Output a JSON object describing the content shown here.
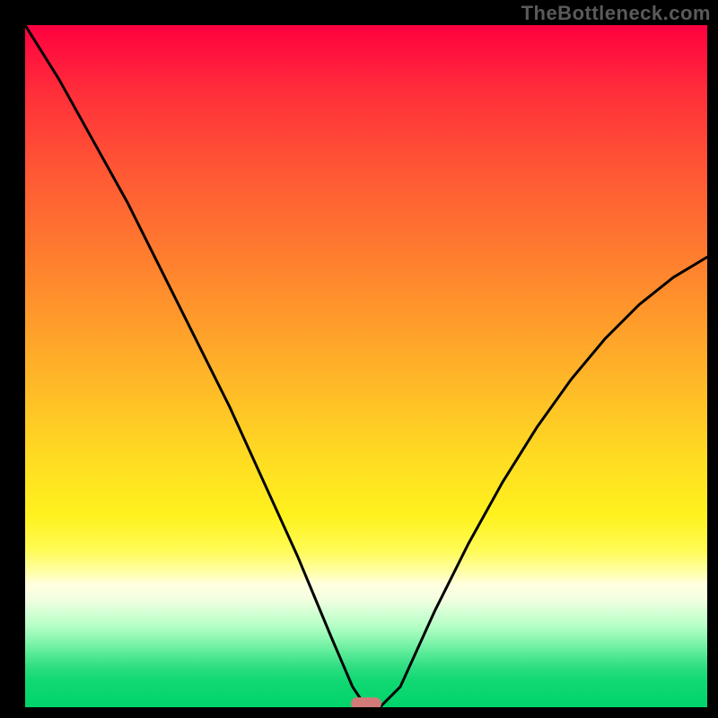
{
  "watermark": "TheBottleneck.com",
  "chart_data": {
    "type": "line",
    "title": "",
    "xlabel": "",
    "ylabel": "",
    "xlim": [
      0,
      100
    ],
    "ylim": [
      0,
      100
    ],
    "series": [
      {
        "name": "bottleneck-curve",
        "x": [
          0,
          5,
          10,
          15,
          20,
          25,
          30,
          35,
          40,
          45,
          48,
          50,
          52,
          55,
          60,
          65,
          70,
          75,
          80,
          85,
          90,
          95,
          100
        ],
        "y": [
          100,
          92,
          83,
          74,
          64,
          54,
          44,
          33,
          22,
          10,
          3,
          0,
          0,
          3,
          14,
          24,
          33,
          41,
          48,
          54,
          59,
          63,
          66
        ]
      }
    ],
    "marker": {
      "x": 50,
      "y": 0
    },
    "gradient_stops": [
      {
        "pos": 0,
        "color": "#ff0040"
      },
      {
        "pos": 50,
        "color": "#ffd024"
      },
      {
        "pos": 80,
        "color": "#ffffd0"
      },
      {
        "pos": 100,
        "color": "#00d46a"
      }
    ]
  }
}
